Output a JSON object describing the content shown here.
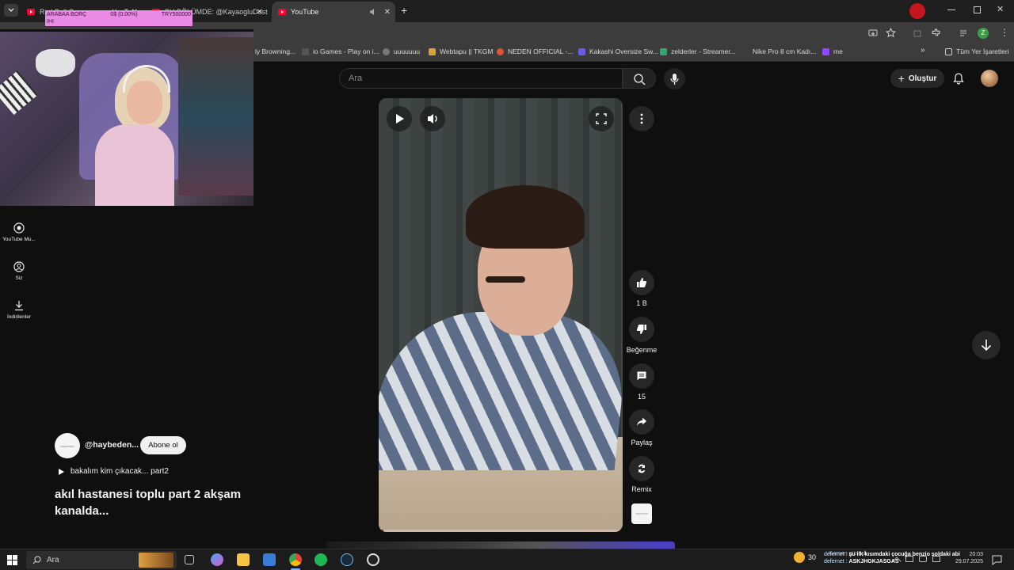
{
  "browser": {
    "tabs": [
      {
        "label": "Red Bull Gamerzone - YouTube",
        "close": "✕"
      },
      {
        "label": "BU BÖLÜMDE: @KayaogluDost...",
        "close": "✕"
      },
      {
        "label": "YouTube",
        "close": "✕"
      }
    ],
    "new_tab": "+",
    "bookmarks": [
      "ly Browning...",
      "io Games - Play on i...",
      "uuuuuuu",
      "Webtapu || TKGM",
      "NEDEN OFFICIAL -...",
      "Kakashi Oversize Sw...",
      "zelderler - Streamer...",
      "Nike Pro 8 cm Kadı...",
      "me"
    ],
    "bookmarks_more": "»",
    "all_bookmarks": "Tüm Yer İşaretleri",
    "profile_letter": "Z"
  },
  "overlay": {
    "donation_label": "ARABAA BORÇ",
    "donation_percent": "0$ (0.00%)",
    "donation_goal": "TRY500000",
    "donation_sub": "IHI"
  },
  "youtube": {
    "search_placeholder": "Ara",
    "create_label": "Oluştur",
    "nav": [
      {
        "label": "YouTube Mu..."
      },
      {
        "label": "Siz"
      },
      {
        "label": "İndirilenler"
      }
    ],
    "actions": {
      "like_count": "1 B",
      "dislike_label": "Beğenme",
      "comment_count": "15",
      "share_label": "Paylaş",
      "remix_label": "Remix"
    },
    "channel": {
      "avatar_text": "haybeden",
      "name": "@haybeden...",
      "subscribe_label": "Abone ol"
    },
    "playlist_line": "bakalım kim çıkacak... part2",
    "video_title": "akıl hastanesi toplu part 2 akşam kanalda...",
    "progress": 0.02
  },
  "taskbar": {
    "search_placeholder": "Ara",
    "weather_temp": "30",
    "weather_desc": "Kısmen güneşli",
    "time": "20:03",
    "date": "29.07.2025"
  },
  "chat": [
    {
      "user": "defernet",
      "message": "şu ilk kısımdaki çocuğa benzio soldaki abi"
    },
    {
      "user": "defernet",
      "message": "ASKJHGKJASGAS"
    }
  ]
}
